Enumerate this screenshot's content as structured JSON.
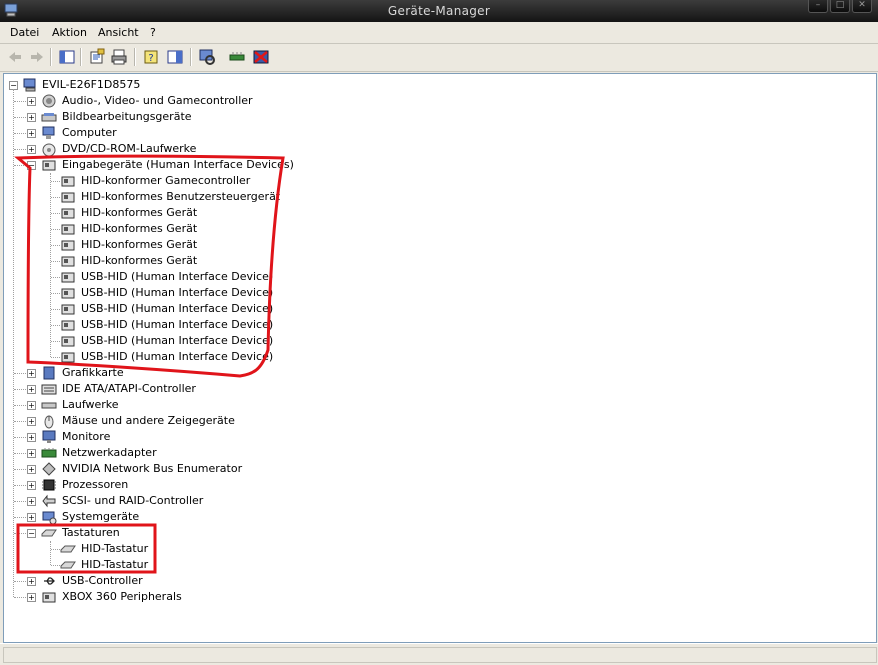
{
  "window": {
    "title": "Geräte-Manager"
  },
  "menu": {
    "items": [
      "Datei",
      "Aktion",
      "Ansicht",
      "?"
    ]
  },
  "tree": {
    "root": "EVIL-E26F1D8575",
    "categories": [
      {
        "label": "Audio-, Video- und Gamecontroller",
        "icon": "speaker-icon",
        "expanded": false
      },
      {
        "label": "Bildbearbeitungsgeräte",
        "icon": "scanner-icon",
        "expanded": false
      },
      {
        "label": "Computer",
        "icon": "computer-icon",
        "expanded": false
      },
      {
        "label": "DVD/CD-ROM-Laufwerke",
        "icon": "cdrom-icon",
        "expanded": false
      },
      {
        "label": "Eingabegeräte (Human Interface Devices)",
        "icon": "hid-icon",
        "expanded": true,
        "children": [
          "HID-konformer Gamecontroller",
          "HID-konformes Benutzersteuergerät",
          "HID-konformes Gerät",
          "HID-konformes Gerät",
          "HID-konformes Gerät",
          "HID-konformes Gerät",
          "USB-HID (Human Interface Device)",
          "USB-HID (Human Interface Device)",
          "USB-HID (Human Interface Device)",
          "USB-HID (Human Interface Device)",
          "USB-HID (Human Interface Device)",
          "USB-HID (Human Interface Device)"
        ]
      },
      {
        "label": "Grafikkarte",
        "icon": "display-adapter-icon",
        "expanded": false
      },
      {
        "label": "IDE ATA/ATAPI-Controller",
        "icon": "ide-controller-icon",
        "expanded": false
      },
      {
        "label": "Laufwerke",
        "icon": "disk-drive-icon",
        "expanded": false
      },
      {
        "label": "Mäuse und andere Zeigegeräte",
        "icon": "mouse-icon",
        "expanded": false
      },
      {
        "label": "Monitore",
        "icon": "monitor-icon",
        "expanded": false
      },
      {
        "label": "Netzwerkadapter",
        "icon": "network-adapter-icon",
        "expanded": false
      },
      {
        "label": "NVIDIA Network Bus Enumerator",
        "icon": "bus-enumerator-icon",
        "expanded": false
      },
      {
        "label": "Prozessoren",
        "icon": "processor-icon",
        "expanded": false
      },
      {
        "label": "SCSI- und RAID-Controller",
        "icon": "scsi-icon",
        "expanded": false
      },
      {
        "label": "Systemgeräte",
        "icon": "system-devices-icon",
        "expanded": false
      },
      {
        "label": "Tastaturen",
        "icon": "keyboard-icon",
        "expanded": true,
        "children": [
          "HID-Tastatur",
          "HID-Tastatur"
        ]
      },
      {
        "label": "USB-Controller",
        "icon": "usb-icon",
        "expanded": false
      },
      {
        "label": "XBOX 360 Peripherals",
        "icon": "xbox-icon",
        "expanded": false
      }
    ]
  },
  "colors": {
    "annotation": "#e0141a",
    "titlebar": "#1e1e1e",
    "selection": "#316ac5"
  }
}
